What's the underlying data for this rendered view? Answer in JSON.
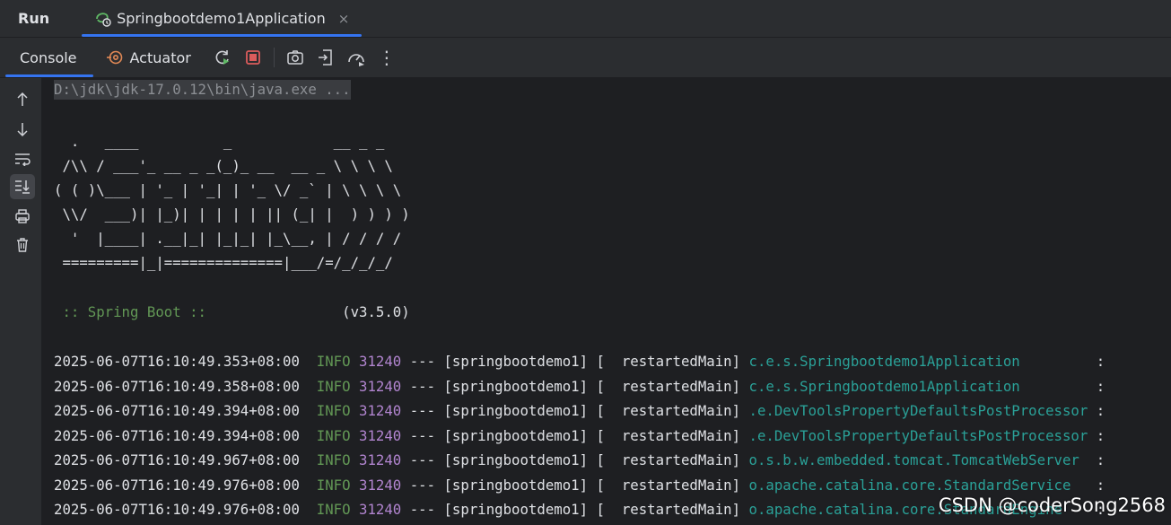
{
  "header": {
    "title": "Run",
    "run_tab": "Springbootdemo1Application",
    "close_glyph": "×"
  },
  "toolbar": {
    "console_tab": "Console",
    "actuator_tab": "Actuator",
    "more_glyph": "⋮"
  },
  "console": {
    "command": "D:\\jdk\\jdk-17.0.12\\bin\\java.exe ...",
    "banner": [
      "  .   ____          _            __ _ _",
      " /\\\\ / ___'_ __ _ _(_)_ __  __ _ \\ \\ \\ \\",
      "( ( )\\___ | '_ | '_| | '_ \\/ _` | \\ \\ \\ \\",
      " \\\\/  ___)| |_)| | | | | || (_| |  ) ) ) )",
      "  '  |____| .__|_| |_|_| |_\\__, | / / / /",
      " =========|_|==============|___/=/_/_/_/"
    ],
    "spring_label": " :: Spring Boot :: ",
    "spring_version": "               (v3.5.0)",
    "logs": [
      {
        "ts": "2025-06-07T16:10:49.353+08:00",
        "level": "INFO",
        "pid": "31240",
        "thread": " --- [springbootdemo1] [  restartedMain] ",
        "logger": "c.e.s.Springbootdemo1Application         ",
        "tail": ":"
      },
      {
        "ts": "2025-06-07T16:10:49.358+08:00",
        "level": "INFO",
        "pid": "31240",
        "thread": " --- [springbootdemo1] [  restartedMain] ",
        "logger": "c.e.s.Springbootdemo1Application         ",
        "tail": ":"
      },
      {
        "ts": "2025-06-07T16:10:49.394+08:00",
        "level": "INFO",
        "pid": "31240",
        "thread": " --- [springbootdemo1] [  restartedMain] ",
        "logger": ".e.DevToolsPropertyDefaultsPostProcessor ",
        "tail": ":"
      },
      {
        "ts": "2025-06-07T16:10:49.394+08:00",
        "level": "INFO",
        "pid": "31240",
        "thread": " --- [springbootdemo1] [  restartedMain] ",
        "logger": ".e.DevToolsPropertyDefaultsPostProcessor ",
        "tail": ":"
      },
      {
        "ts": "2025-06-07T16:10:49.967+08:00",
        "level": "INFO",
        "pid": "31240",
        "thread": " --- [springbootdemo1] [  restartedMain] ",
        "logger": "o.s.b.w.embedded.tomcat.TomcatWebServer  ",
        "tail": ":"
      },
      {
        "ts": "2025-06-07T16:10:49.976+08:00",
        "level": "INFO",
        "pid": "31240",
        "thread": " --- [springbootdemo1] [  restartedMain] ",
        "logger": "o.apache.catalina.core.StandardService   ",
        "tail": ":"
      },
      {
        "ts": "2025-06-07T16:10:49.976+08:00",
        "level": "INFO",
        "pid": "31240",
        "thread": " --- [springbootdemo1] [  restartedMain] ",
        "logger": "o.apache.catalina.core.StandardEngine    ",
        "tail": ":"
      }
    ]
  },
  "watermark": "CSDN @coderSong2568",
  "colors": {
    "accent": "#3574f0",
    "stop_red": "#db5c5c",
    "rerun_green": "#5fb865",
    "actuator_orange": "#e08855",
    "info_green": "#629755",
    "pid_purple": "#b285d0",
    "logger_teal": "#2aa198"
  },
  "icons": {
    "app_tab": "spring-run-icon",
    "actuator": "actuator-icon",
    "rerun": "rerun-icon",
    "stop": "stop-icon",
    "screenshot": "camera-icon",
    "attach": "attach-debugger-icon",
    "profiler": "profiler-icon",
    "more": "more-options-icon",
    "up": "arrow-up-icon",
    "down": "arrow-down-icon",
    "soft_wrap": "soft-wrap-icon",
    "scroll_end": "scroll-to-end-icon",
    "print": "print-icon",
    "clear": "trash-icon"
  }
}
